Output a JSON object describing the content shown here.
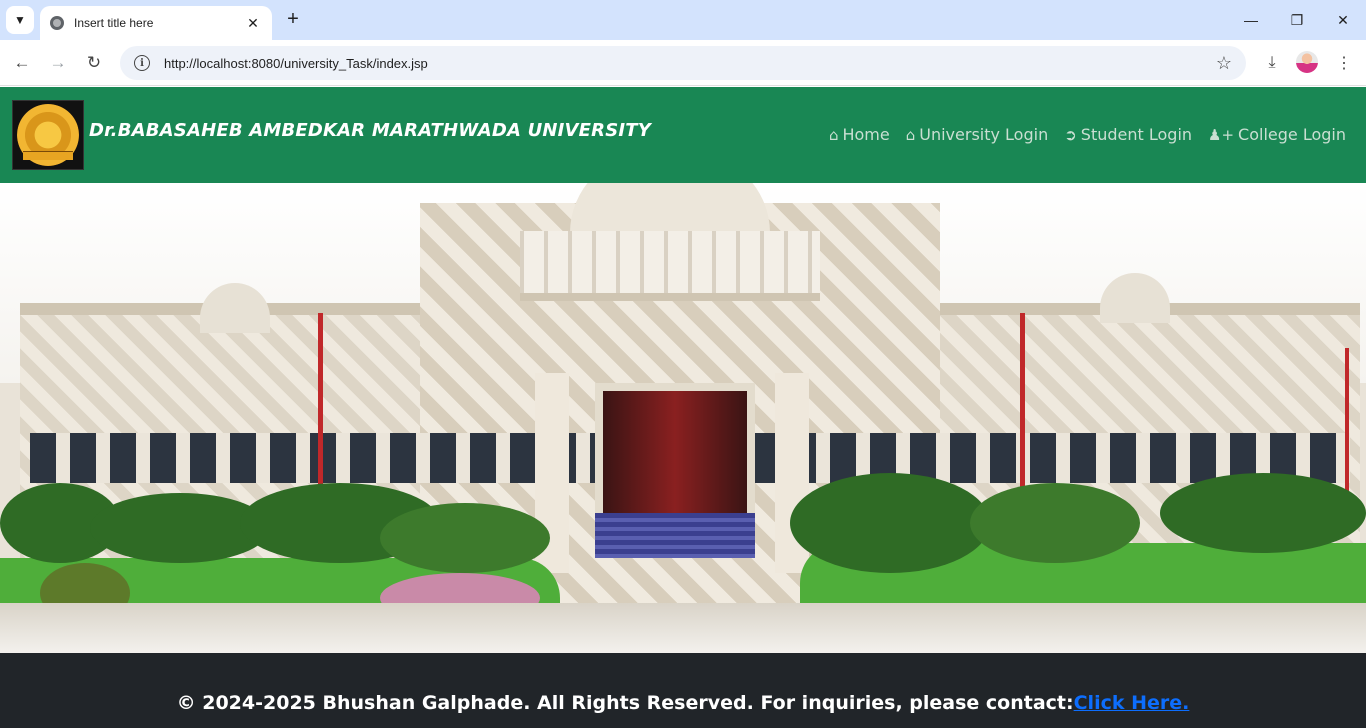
{
  "browser": {
    "tab_title": "Insert title here",
    "url": "http://localhost:8080/university_Task/index.jsp",
    "icons": {
      "tab_search": "chevron-down-icon",
      "close_tab": "close-icon",
      "new_tab": "plus-icon",
      "back": "arrow-left-icon",
      "forward": "arrow-right-icon",
      "reload": "reload-icon",
      "site_info": "info-icon",
      "bookmark": "star-icon",
      "downloads": "download-icon",
      "menu": "kebab-menu-icon"
    }
  },
  "header": {
    "brand": "Dr.BABASAHEB AMBEDKAR MARATHWADA UNIVERSITY",
    "background": "#198754",
    "nav": [
      {
        "label": "Home",
        "icon": "home-icon"
      },
      {
        "label": "University Login",
        "icon": "home-icon"
      },
      {
        "label": "Student Login",
        "icon": "sign-in-icon"
      },
      {
        "label": "College Login",
        "icon": "user-plus-icon"
      }
    ]
  },
  "hero": {
    "image": "university-building-photo"
  },
  "footer": {
    "text": "© 2024-2025 Bhushan Galphade. All Rights Reserved. For inquiries, please contact:",
    "link_label": "Click Here.",
    "background": "#212529",
    "link_color": "#0d6efd"
  }
}
